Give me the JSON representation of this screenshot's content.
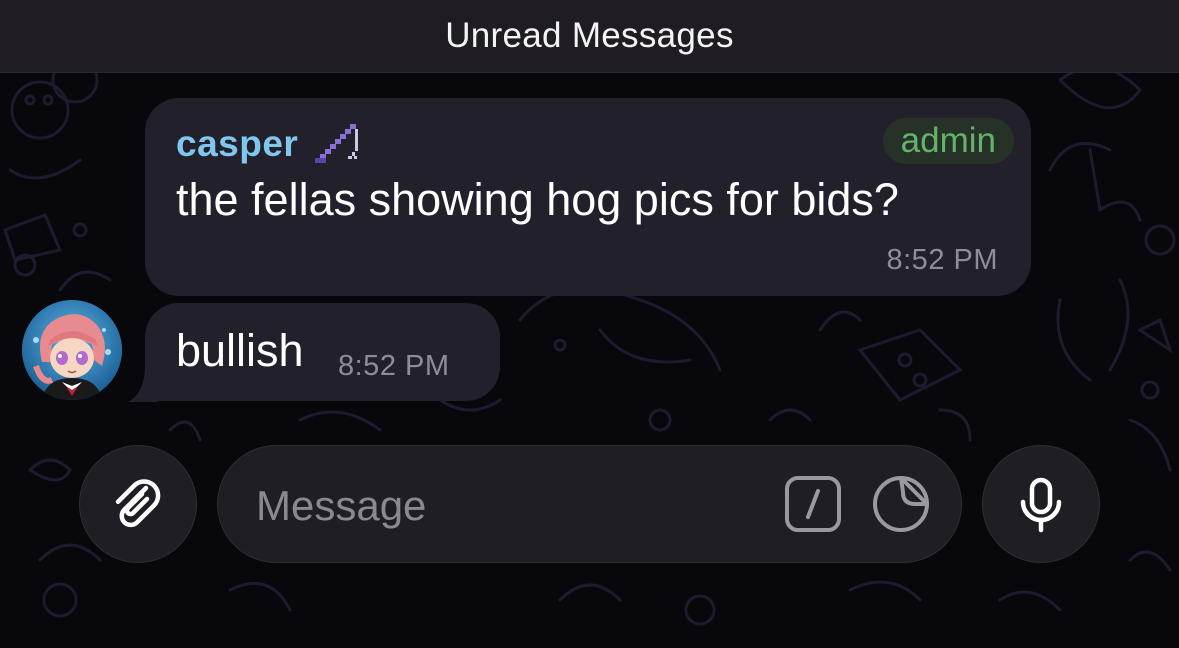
{
  "header": {
    "unread_label": "Unread Messages"
  },
  "messages": [
    {
      "sender": "casper",
      "badge": "admin",
      "text": "the fellas showing hog pics for bids?",
      "time": "8:52 PM",
      "emoji_status_icon": "fishing-rod-icon"
    },
    {
      "text": "bullish",
      "time": "8:52 PM",
      "avatar_icon": "anime-avatar"
    }
  ],
  "composer": {
    "placeholder": "Message",
    "attach_icon": "paperclip-icon",
    "command_icon": "slash-command-icon",
    "sticker_icon": "sticker-icon",
    "mic_icon": "microphone-icon"
  },
  "colors": {
    "sender_name": "#7fc7ee",
    "admin_badge": "#63b466",
    "bubble": "#22212b",
    "timestamp": "#8e8c96",
    "header_bg": "#1f1c24"
  }
}
